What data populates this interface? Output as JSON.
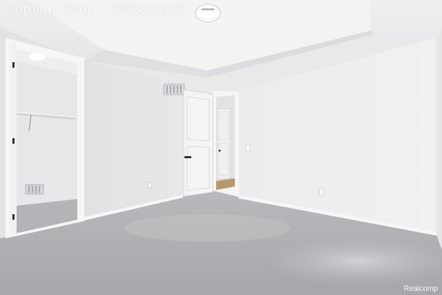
{
  "banner": {
    "text": "Coming Soon - 06/28/2025"
  },
  "watermark": {
    "text": "Realcomp"
  }
}
